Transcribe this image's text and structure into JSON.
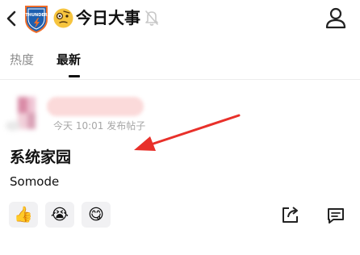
{
  "header": {
    "title": "今日大事",
    "title_emoji": "🧐",
    "team_logo_text": "THUNDER",
    "back_icon": "chevron-left-icon",
    "mute_icon": "bell-off-icon",
    "profile_icon": "person-icon"
  },
  "tabs": [
    {
      "label": "热度",
      "active": false
    },
    {
      "label": "最新",
      "active": true
    }
  ],
  "post": {
    "meta": "今天 10:01 发布帖子",
    "title": "系统家园",
    "body": "Somode",
    "reactions": [
      {
        "emoji": "👍",
        "icon": "thumbs-up-icon"
      },
      {
        "emoji": "😭",
        "icon": "crying-face-icon"
      },
      {
        "emoji": "😋",
        "icon": "yum-face-icon"
      }
    ],
    "share_icon": "share-icon",
    "comment_icon": "comment-icon"
  },
  "colors": {
    "text": "#111111",
    "muted": "#8a8a8a",
    "meta": "#a7a7a7",
    "reaction_bg": "#f1f1f3",
    "annotation_arrow": "#e8302a",
    "logo_blue": "#1d5fb0",
    "logo_orange": "#ef6e2a"
  }
}
